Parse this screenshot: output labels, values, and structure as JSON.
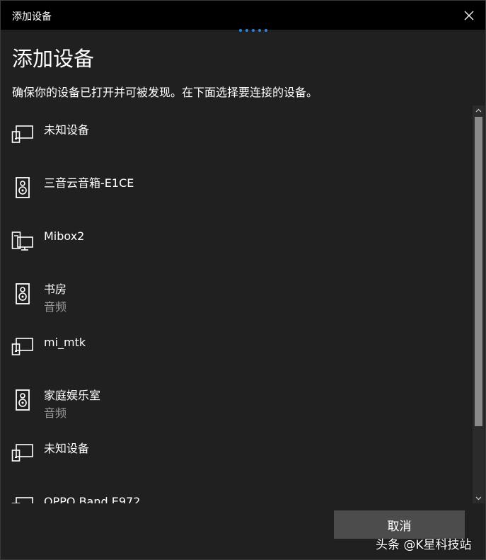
{
  "window": {
    "title": "添加设备"
  },
  "main": {
    "heading": "添加设备",
    "instructions": "确保你的设备已打开并可被发现。在下面选择要连接的设备。"
  },
  "devices": [
    {
      "name": "未知设备",
      "subtitle": "",
      "icon": "display-device-icon"
    },
    {
      "name": "三音云音箱-E1CE",
      "subtitle": "",
      "icon": "speaker-icon"
    },
    {
      "name": "Mibox2",
      "subtitle": "",
      "icon": "computer-icon"
    },
    {
      "name": "书房",
      "subtitle": "音频",
      "icon": "speaker-icon"
    },
    {
      "name": "mi_mtk",
      "subtitle": "",
      "icon": "display-device-icon"
    },
    {
      "name": "家庭娱乐室",
      "subtitle": "音频",
      "icon": "speaker-icon"
    },
    {
      "name": "未知设备",
      "subtitle": "",
      "icon": "display-device-icon"
    },
    {
      "name": "OPPO Band E972",
      "subtitle": "",
      "icon": "display-device-icon"
    }
  ],
  "buttons": {
    "cancel": "取消"
  },
  "watermark": "头条 @K星科技站",
  "colors": {
    "background": "#202020",
    "titlebar": "#000000",
    "accent": "#2a83e0",
    "button": "#4c4c4c",
    "secondary_text": "#9a9a9a"
  }
}
